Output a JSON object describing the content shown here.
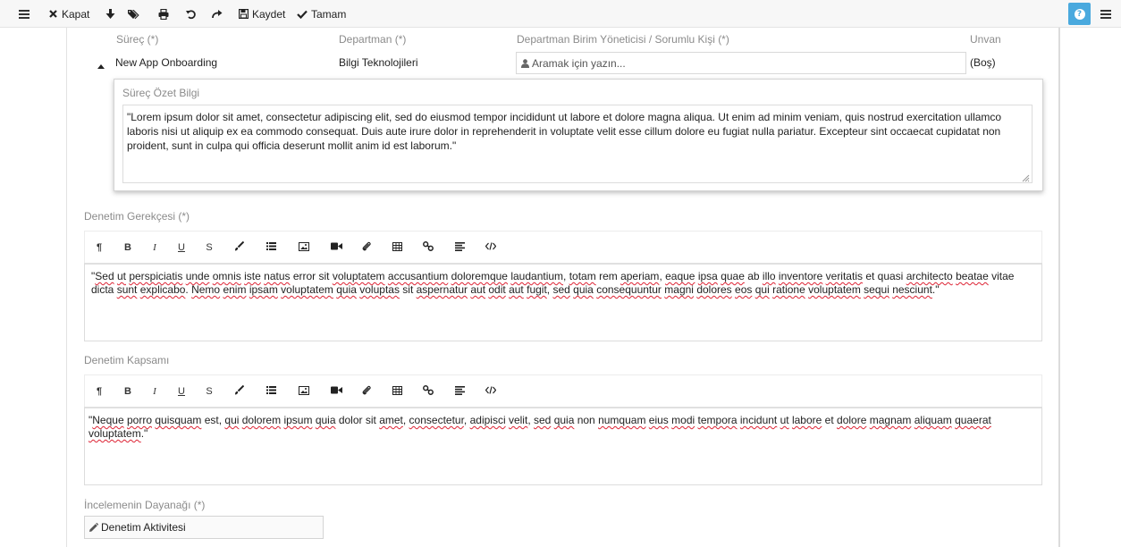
{
  "toolbar": {
    "close_label": "Kapat",
    "save_label": "Kaydet",
    "done_label": "Tamam"
  },
  "process_header": {
    "process_label": "Süreç (*)",
    "department_label": "Departman (*)",
    "manager_label": "Departman Birim Yöneticisi / Sorumlu Kişi (*)",
    "title_label": "Unvan"
  },
  "process_row": {
    "process_name": "New App Onboarding",
    "department": "Bilgi Teknolojileri",
    "manager_placeholder": "Aramak için yazın...",
    "title_value": "(Boş)"
  },
  "summary": {
    "label": "Süreç Özet Bilgi",
    "text": "\"Lorem ipsum dolor sit amet, consectetur adipiscing elit, sed do eiusmod tempor incididunt ut labore et dolore magna aliqua. Ut enim ad minim veniam, quis nostrud exercitation ullamco laboris nisi ut aliquip ex ea commodo consequat. Duis aute irure dolor in reprehenderit in voluptate velit esse cillum dolore eu fugiat nulla pariatur. Excepteur sint occaecat cupidatat non proident, sunt in culpa qui officia deserunt mollit anim id est laborum.\""
  },
  "audit_reason": {
    "label": "Denetim Gerekçesi (*)"
  },
  "audit_scope": {
    "label": "Denetim Kapsamı"
  },
  "editor_tools": {
    "paragraph": "¶",
    "bold": "B",
    "italic": "I",
    "underline": "U",
    "strike": "S"
  },
  "basis": {
    "label": "İncelemenin Dayanağı (*)",
    "value": "Denetim Aktivitesi"
  },
  "colors": {
    "accent": "#4aa9de",
    "spellcheck": "#dd2233"
  },
  "icons": [
    "menu-icon",
    "close-icon",
    "download-icon",
    "tags-icon",
    "print-icon",
    "undo-icon",
    "redo-icon",
    "save-icon",
    "check-icon",
    "help-icon",
    "user-icon",
    "pencil-icon"
  ]
}
